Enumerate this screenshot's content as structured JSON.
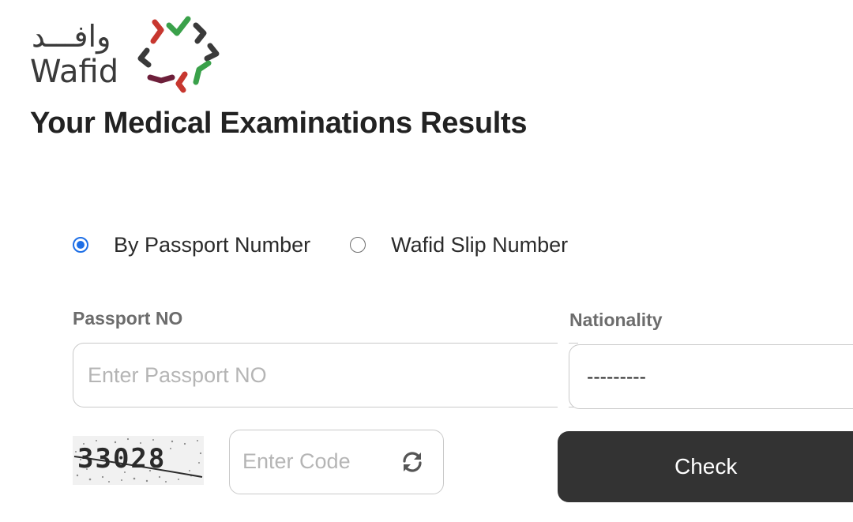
{
  "brand": {
    "arabic_name": "وافـــد",
    "latin_name": "Wafid",
    "colors": {
      "green": "#3aa14a",
      "red": "#c7372f",
      "dark": "#3a3a3a",
      "maroon": "#6d1f3a"
    }
  },
  "page": {
    "title": "Your Medical Examinations Results"
  },
  "search_mode": {
    "options": [
      {
        "label": "By Passport Number",
        "selected": true
      },
      {
        "label": "Wafid Slip Number",
        "selected": false
      }
    ]
  },
  "form": {
    "passport": {
      "label": "Passport NO",
      "placeholder": "Enter Passport NO",
      "value": ""
    },
    "nationality": {
      "label": "Nationality",
      "selected": "---------"
    },
    "captcha": {
      "image_text": "33028",
      "placeholder": "Enter Code",
      "value": "",
      "refresh_icon": "refresh-icon"
    },
    "submit_label": "Check"
  },
  "accent_color": "#1e6fe6",
  "button_color": "#333333"
}
